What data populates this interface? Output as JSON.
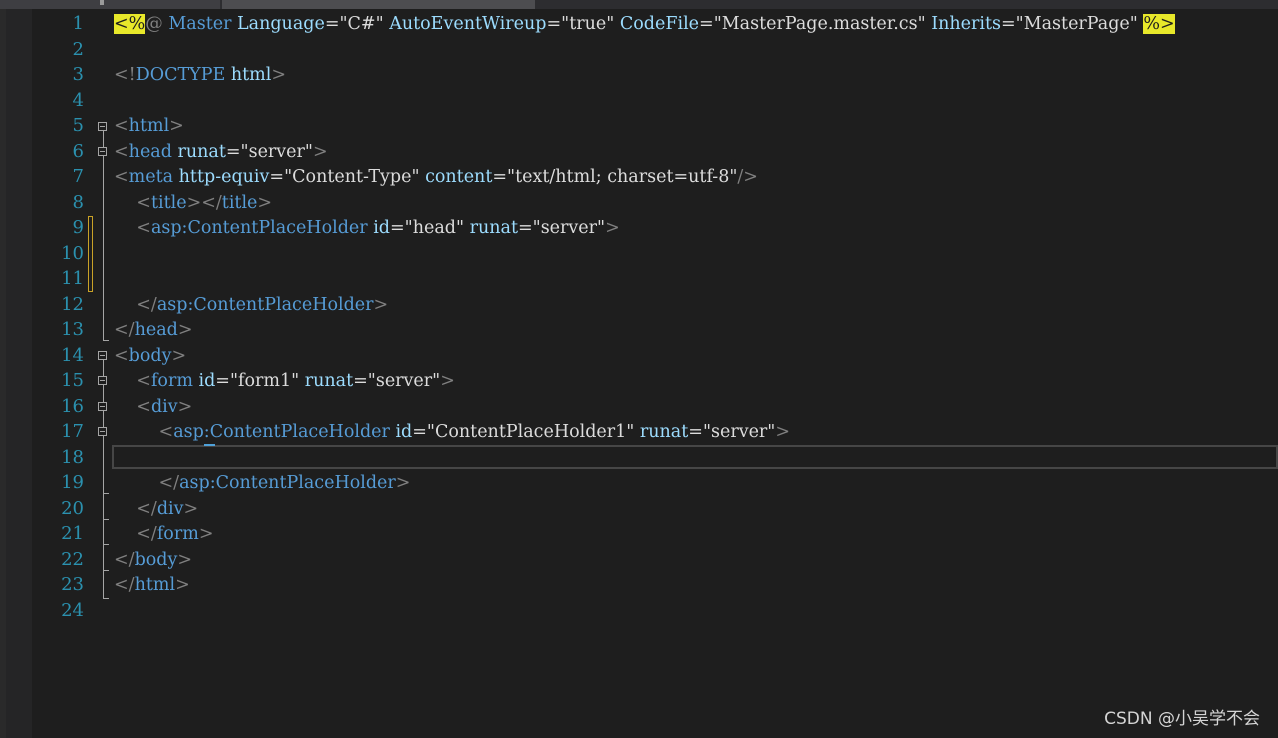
{
  "editor": {
    "line_numbers": [
      "1",
      "2",
      "3",
      "4",
      "5",
      "6",
      "7",
      "8",
      "9",
      "10",
      "11",
      "12",
      "13",
      "14",
      "15",
      "16",
      "17",
      "18",
      "19",
      "20",
      "21",
      "22",
      "23",
      "24"
    ],
    "lines": {
      "l1": {
        "d1": "<%",
        "d1b": "@",
        "kw": " Master",
        "a1": " Language",
        "e1": "=",
        "v1": "\"C#\"",
        "a2": " AutoEventWireup",
        "e2": "=",
        "v2": "\"true\"",
        "a3": " CodeFile",
        "e3": "=",
        "v3": "\"MasterPage.master.cs\"",
        "a4": " Inherits",
        "e4": "=",
        "v4": "\"MasterPage\"",
        "sp": " ",
        "d2": "%>"
      },
      "l3": {
        "o": "<!",
        "t": "DOCTYPE",
        "a": " html",
        "c": ">"
      },
      "l5": {
        "o": "<",
        "t": "html",
        "c": ">"
      },
      "l6": {
        "o": "<",
        "t": "head",
        "a1": " runat",
        "e1": "=",
        "v1": "\"server\"",
        "c": ">"
      },
      "l7": {
        "o": "<",
        "t": "meta",
        "a1": " http-equiv",
        "e1": "=",
        "v1": "\"Content-Type\"",
        "a2": " content",
        "e2": "=",
        "v2": "\"text/html; charset=utf-8\"",
        "c": "/>"
      },
      "l8": {
        "ind": "    ",
        "o": "<",
        "t": "title",
        "m": "></",
        "t2": "title",
        "c": ">"
      },
      "l9": {
        "ind": "    ",
        "o": "<",
        "t": "asp:ContentPlaceHolder",
        "a1": " id",
        "e1": "=",
        "v1": "\"head\"",
        "a2": " runat",
        "e2": "=",
        "v2": "\"server\"",
        "c": ">"
      },
      "l12": {
        "ind": "    ",
        "o": "</",
        "t": "asp:ContentPlaceHolder",
        "c": ">"
      },
      "l13": {
        "o": "</",
        "t": "head",
        "c": ">"
      },
      "l14": {
        "o": "<",
        "t": "body",
        "c": ">"
      },
      "l15": {
        "ind": "    ",
        "o": "<",
        "t": "form",
        "a1": " id",
        "e1": "=",
        "v1": "\"form1\"",
        "a2": " runat",
        "e2": "=",
        "v2": "\"server\"",
        "c": ">"
      },
      "l16": {
        "ind": "    ",
        "o": "<",
        "t": "div",
        "c": ">"
      },
      "l17": {
        "ind": "        ",
        "o": "<",
        "t": "asp:ContentPlaceHolder",
        "a1": " id",
        "e1": "=",
        "v1": "\"ContentPlaceHolder1\"",
        "a2": " runat",
        "e2": "=",
        "v2": "\"server\"",
        "c": ">"
      },
      "l19": {
        "ind": "        ",
        "o": "</",
        "t": "asp:ContentPlaceHolder",
        "c": ">"
      },
      "l20": {
        "ind": "    ",
        "o": "</",
        "t": "div",
        "c": ">"
      },
      "l21": {
        "ind": "    ",
        "o": "</",
        "t": "form",
        "c": ">"
      },
      "l22": {
        "o": "</",
        "t": "body",
        "c": ">"
      },
      "l23": {
        "o": "</",
        "t": "html",
        "c": ">"
      }
    }
  },
  "watermark": "CSDN @小吴学不会",
  "colors": {
    "background": "#1e1e1e",
    "line_number": "#2b91af",
    "tag": "#569cd6",
    "bracket": "#808080",
    "attribute": "#9cdcfe",
    "value": "#dcdcdc",
    "directive_highlight": "#e8e82a"
  }
}
